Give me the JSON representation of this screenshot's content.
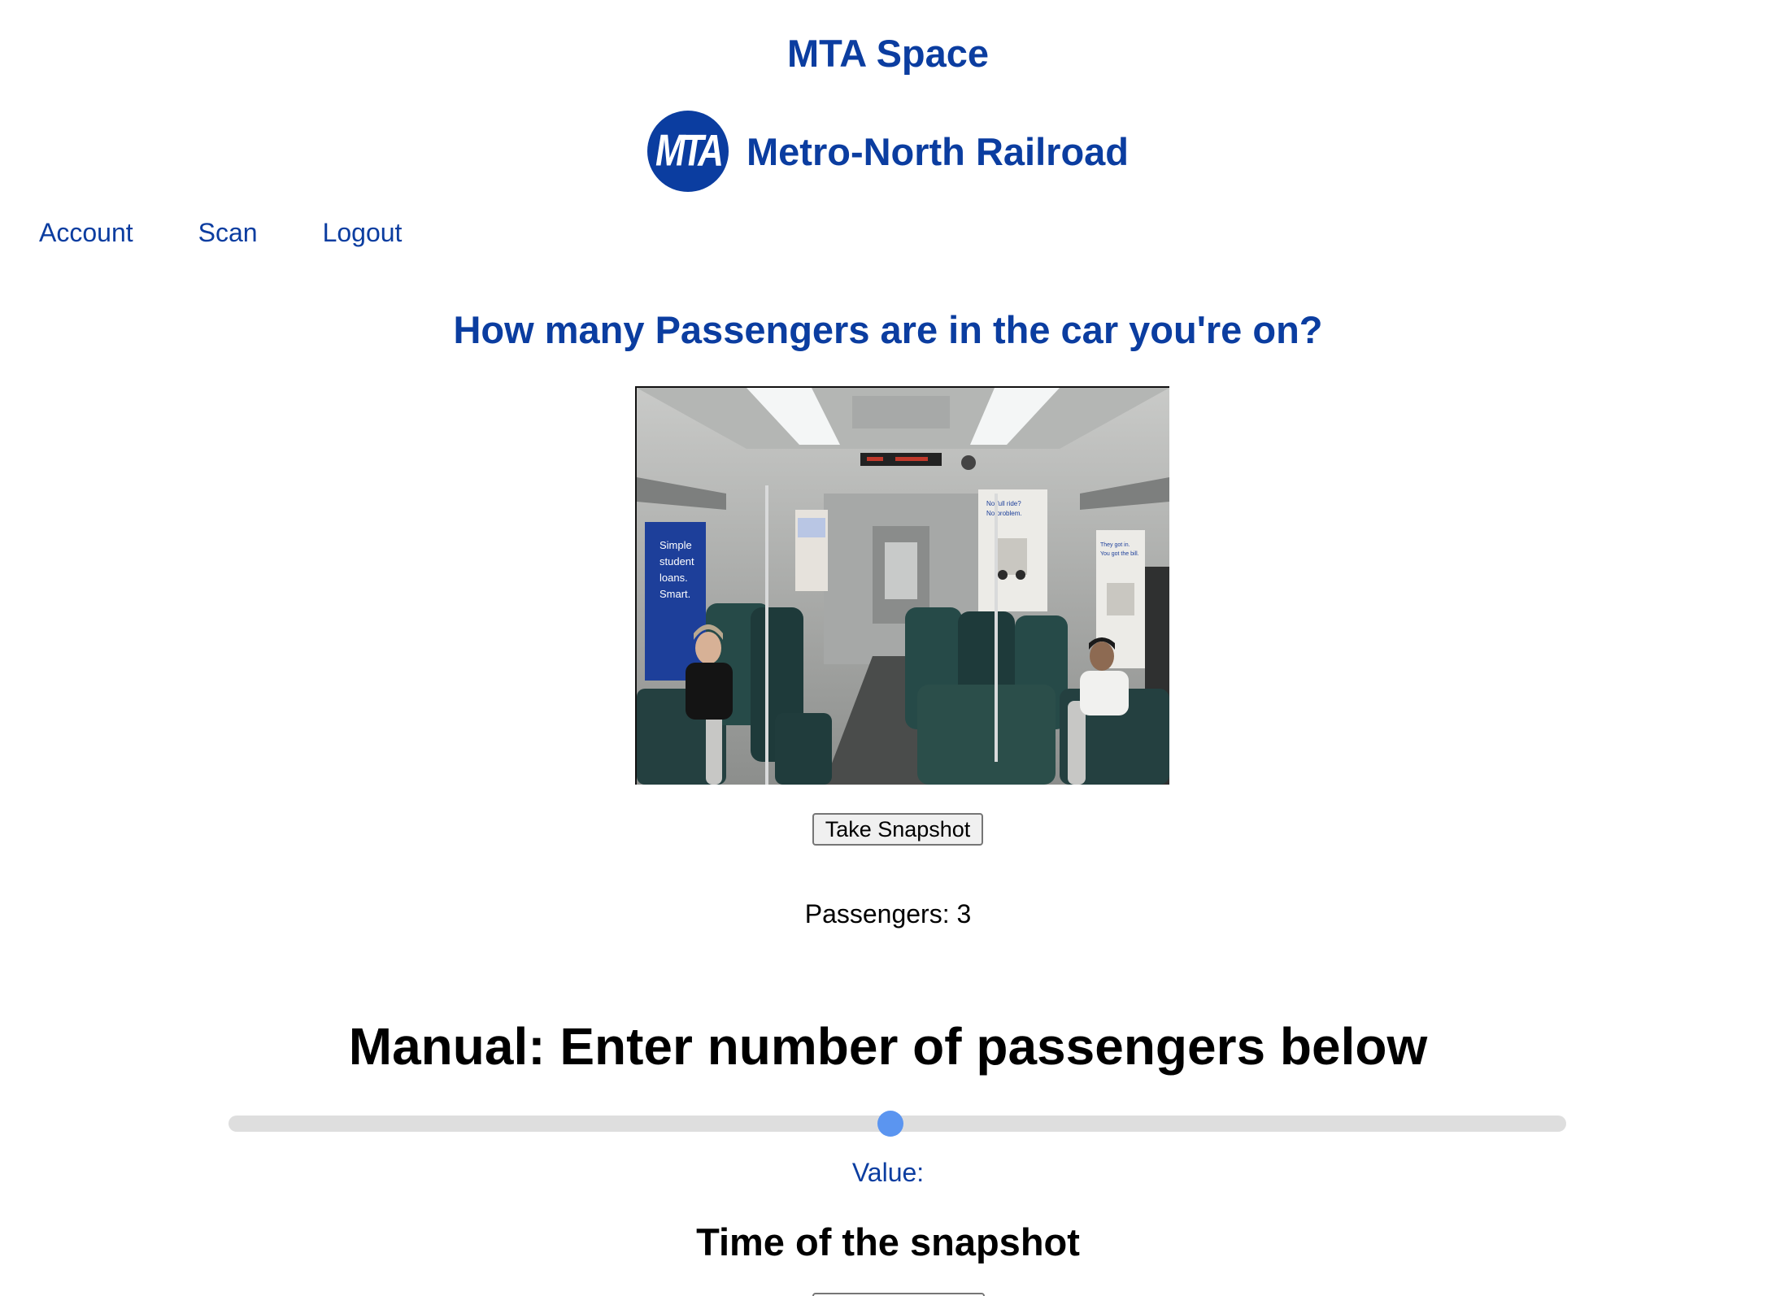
{
  "app": {
    "title": "MTA Space"
  },
  "brand": {
    "logo_text": "MTA",
    "name": "Metro-North Railroad",
    "color": "#0b3da0"
  },
  "nav": {
    "items": [
      {
        "label": "Account"
      },
      {
        "label": "Scan"
      },
      {
        "label": "Logout"
      }
    ]
  },
  "question": "How many Passengers are in the car you're on?",
  "camera": {
    "poster_left": [
      "Simple",
      "student",
      "loans.",
      "Smart."
    ],
    "poster_right_top": [
      "No full ride?",
      "No problem."
    ],
    "poster_right": [
      "They got in.",
      "You got the bill."
    ]
  },
  "snapshot": {
    "button_label": "Take Snapshot"
  },
  "result": {
    "passengers_text": "Passengers: 3"
  },
  "manual": {
    "title": "Manual: Enter number of passengers below",
    "slider_fraction": 0.495,
    "accent_color": "#5b95f0",
    "value_label": "Value:"
  },
  "time": {
    "title": "Time of the snapshot"
  }
}
